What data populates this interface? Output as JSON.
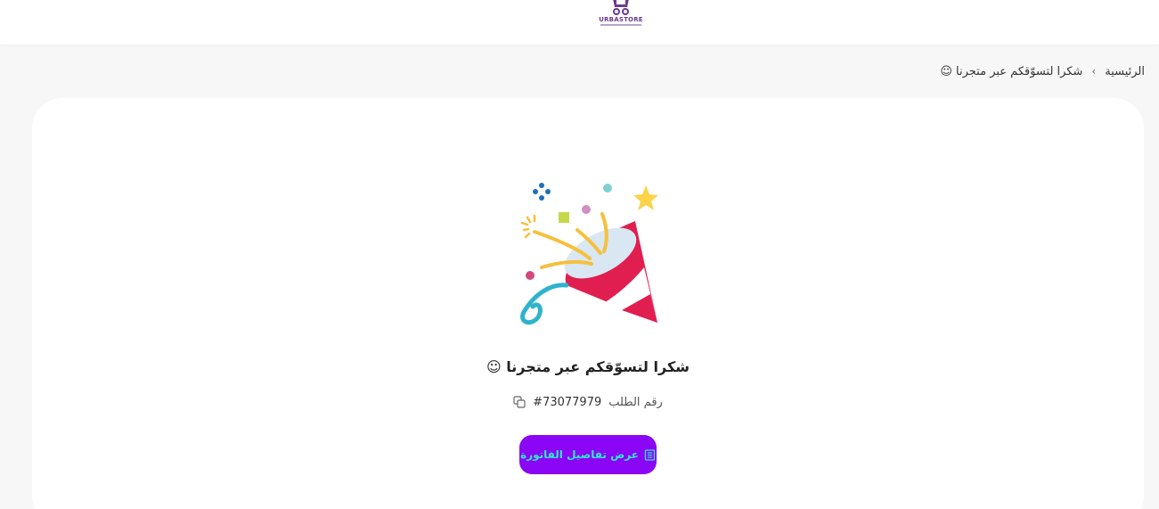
{
  "header": {
    "logo_text": "URBASTORE"
  },
  "breadcrumb": {
    "home": "الرئيسية",
    "separator": "›",
    "current": "شكرا لتسوّقكم عبر متجرنا ☺"
  },
  "main": {
    "illustration": "party-popper-icon",
    "thanks_message": "شكرا لتسوّقكم عبر متجرنا ☺",
    "order_label": "رقم الطلب",
    "order_number": "#73077979",
    "invoice_button": "عرض تفاصيل الفاتورة"
  },
  "colors": {
    "accent": "#8a06f5",
    "button_text": "#2ee8d6",
    "background": "#f7f7f8",
    "card": "#ffffff"
  }
}
